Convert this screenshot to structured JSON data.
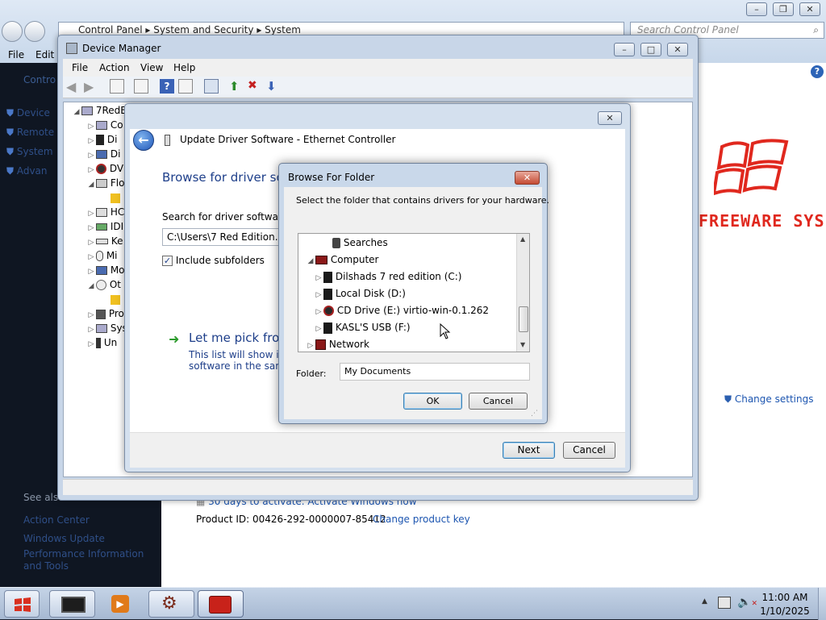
{
  "control_panel": {
    "breadcrumb": [
      "Control Panel",
      "System and Security",
      "System"
    ],
    "search_placeholder": "Search Control Panel",
    "menu": [
      "File",
      "Edit"
    ],
    "sidebar_home": "Contro",
    "sidebar_links": [
      "Device",
      "Remote",
      "System",
      "Advan"
    ],
    "see_also": "See also",
    "see_also_links": [
      "Action Center",
      "Windows Update",
      "Performance Information and Tools"
    ],
    "change_settings": "Change settings",
    "activation_text": "30 days to activate. Activate Windows now",
    "product_id_label": "Product ID: 00426-292-0000007-85412",
    "change_product_key": "Change product key",
    "logo_text": "FREEWARE SYS"
  },
  "device_manager": {
    "title": "Device Manager",
    "menu": [
      "File",
      "Action",
      "View",
      "Help"
    ],
    "root": "7RedE",
    "tree": [
      "Co",
      "Di",
      "Di",
      "DV",
      "Flo",
      "",
      "HC",
      "IDI",
      "Ke",
      "Mi",
      "Mo",
      "Ot",
      "",
      "Pro",
      "Sys",
      "Un"
    ]
  },
  "update_driver": {
    "title": "Update Driver Software - Ethernet Controller",
    "heading": "Browse for driver sof",
    "search_label": "Search for driver software in",
    "path_value": "C:\\Users\\7 Red Edition.7Re",
    "include_subfolders": "Include subfolders",
    "pick_title": "Let me pick from",
    "pick_desc_1": "This list will show inst",
    "pick_desc_2": "software in the same",
    "next": "Next",
    "cancel": "Cancel"
  },
  "browse_folder": {
    "title": "Browse For Folder",
    "instruction": "Select the folder that contains drivers for your hardware.",
    "items": [
      {
        "label": "Searches",
        "icon": "searches-icon",
        "arrow": ""
      },
      {
        "label": "Computer",
        "icon": "computer-icon",
        "arrow": "◢"
      },
      {
        "label": "Dilshads 7 red edition (C:)",
        "icon": "drive-icon",
        "arrow": "▷"
      },
      {
        "label": "Local Disk (D:)",
        "icon": "drive-icon",
        "arrow": "▷"
      },
      {
        "label": "CD Drive (E:) virtio-win-0.1.262",
        "icon": "cd-drive-icon",
        "arrow": "▷"
      },
      {
        "label": "KASL'S USB (F:)",
        "icon": "usb-drive-icon",
        "arrow": "▷"
      },
      {
        "label": "Network",
        "icon": "network-icon",
        "arrow": "▷"
      }
    ],
    "folder_label": "Folder:",
    "folder_value": "My Documents",
    "ok": "OK",
    "cancel": "Cancel"
  },
  "taskbar": {
    "time": "11:00 AM",
    "date": "1/10/2025"
  },
  "colors": {
    "accent_link": "#1c55b0",
    "logo_red": "#e0281e",
    "dialog_heading": "#1e3f8a"
  }
}
